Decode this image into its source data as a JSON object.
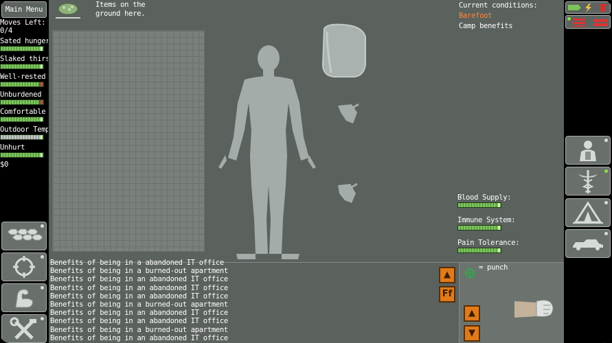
{
  "menu": {
    "main_menu_label": "Main Menu"
  },
  "stats": [
    {
      "label": "Moves Left:",
      "value": "0/4"
    },
    {
      "label": "Sated hunger",
      "level": 0.95
    },
    {
      "label": "Slaked thirst",
      "level": 0.95
    },
    {
      "label": "Well-rested",
      "level": 0.9
    },
    {
      "label": "Unburdened",
      "level": 0.9
    },
    {
      "label": "Comfortable",
      "level": 0.95
    },
    {
      "label": "Outdoor Temp",
      "level": 0.95
    },
    {
      "label": "Unhurt",
      "level": 0.95
    },
    {
      "label": "$0"
    }
  ],
  "ground": {
    "label": "Items on the ground here."
  },
  "conditions": {
    "header": "Current conditions:",
    "items": [
      "Barefoot",
      "Camp benefits"
    ]
  },
  "body_readouts": [
    {
      "label": "Blood Supply:"
    },
    {
      "label": "Immune System:"
    },
    {
      "label": "Pain Tolerance:"
    }
  ],
  "log": {
    "messages": [
      "Benefits of being in a abandoned IT office",
      "Benefits of being in a burned-out apartment",
      "Benefits of being in an abandoned IT office",
      "Benefits of being in an abandoned IT office",
      "Benefits of being in an abandoned IT office",
      "Benefits of being in a burned-out apartment",
      "Benefits of being in an abandoned IT office",
      "Benefits of being in an abandoned IT office",
      "Benefits of being in a burned-out apartment",
      "Benefits of being in an abandoned IT office"
    ],
    "font_button_label": "Ff"
  },
  "attack": {
    "label": "= punch"
  },
  "colors": {
    "panel_bg": "#5b615d",
    "accent_orange": "#e07a1a",
    "condition_orange": "#ff8a3d",
    "bar_green": "#7bc35a"
  }
}
